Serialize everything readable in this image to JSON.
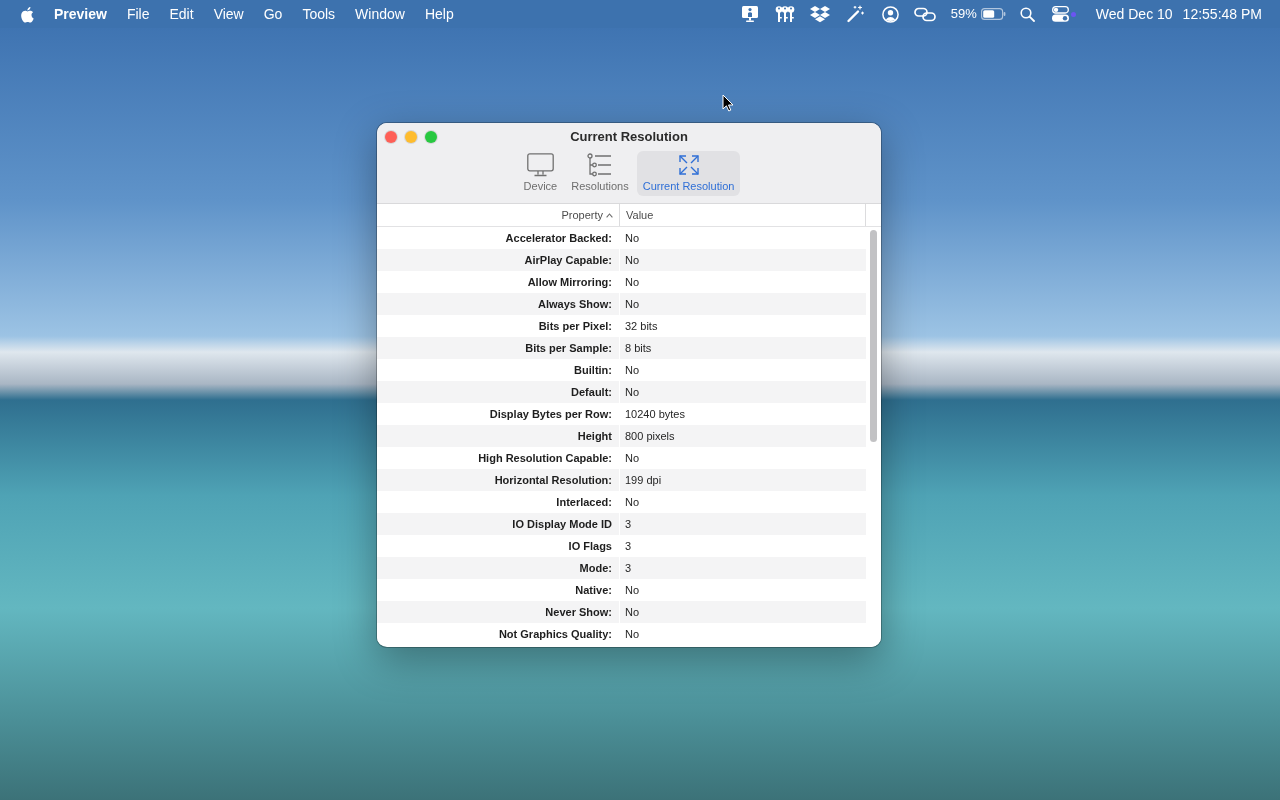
{
  "menu_bar": {
    "app_name": "Preview",
    "menus": [
      "File",
      "Edit",
      "View",
      "Go",
      "Tools",
      "Window",
      "Help"
    ],
    "battery_percent": "59%",
    "date": "Wed Dec 10",
    "time": "12:55:48 PM"
  },
  "window": {
    "title": "Current Resolution"
  },
  "toolbar": {
    "tabs": [
      {
        "label": "Device",
        "selected": false
      },
      {
        "label": "Resolutions",
        "selected": false
      },
      {
        "label": "Current Resolution",
        "selected": true
      }
    ]
  },
  "table": {
    "columns": [
      {
        "label": "Property",
        "sorted_ascending": true
      },
      {
        "label": "Value",
        "sorted_ascending": false
      }
    ],
    "rows": [
      {
        "property": "Accelerator Backed:",
        "value": "No"
      },
      {
        "property": "AirPlay Capable:",
        "value": "No"
      },
      {
        "property": "Allow Mirroring:",
        "value": "No"
      },
      {
        "property": "Always Show:",
        "value": "No"
      },
      {
        "property": "Bits per Pixel:",
        "value": "32 bits"
      },
      {
        "property": "Bits per Sample:",
        "value": "8 bits"
      },
      {
        "property": "Builtin:",
        "value": "No"
      },
      {
        "property": "Default:",
        "value": "No"
      },
      {
        "property": "Display Bytes per Row:",
        "value": "10240 bytes"
      },
      {
        "property": "Height",
        "value": "800 pixels"
      },
      {
        "property": "High Resolution Capable:",
        "value": "No"
      },
      {
        "property": "Horizontal Resolution:",
        "value": "199 dpi"
      },
      {
        "property": "Interlaced:",
        "value": "No"
      },
      {
        "property": "IO Display Mode ID",
        "value": "3"
      },
      {
        "property": "IO Flags",
        "value": "3"
      },
      {
        "property": "Mode:",
        "value": "3"
      },
      {
        "property": "Native:",
        "value": "No"
      },
      {
        "property": "Never Show:",
        "value": "No"
      },
      {
        "property": "Not Graphics Quality:",
        "value": "No"
      }
    ]
  }
}
